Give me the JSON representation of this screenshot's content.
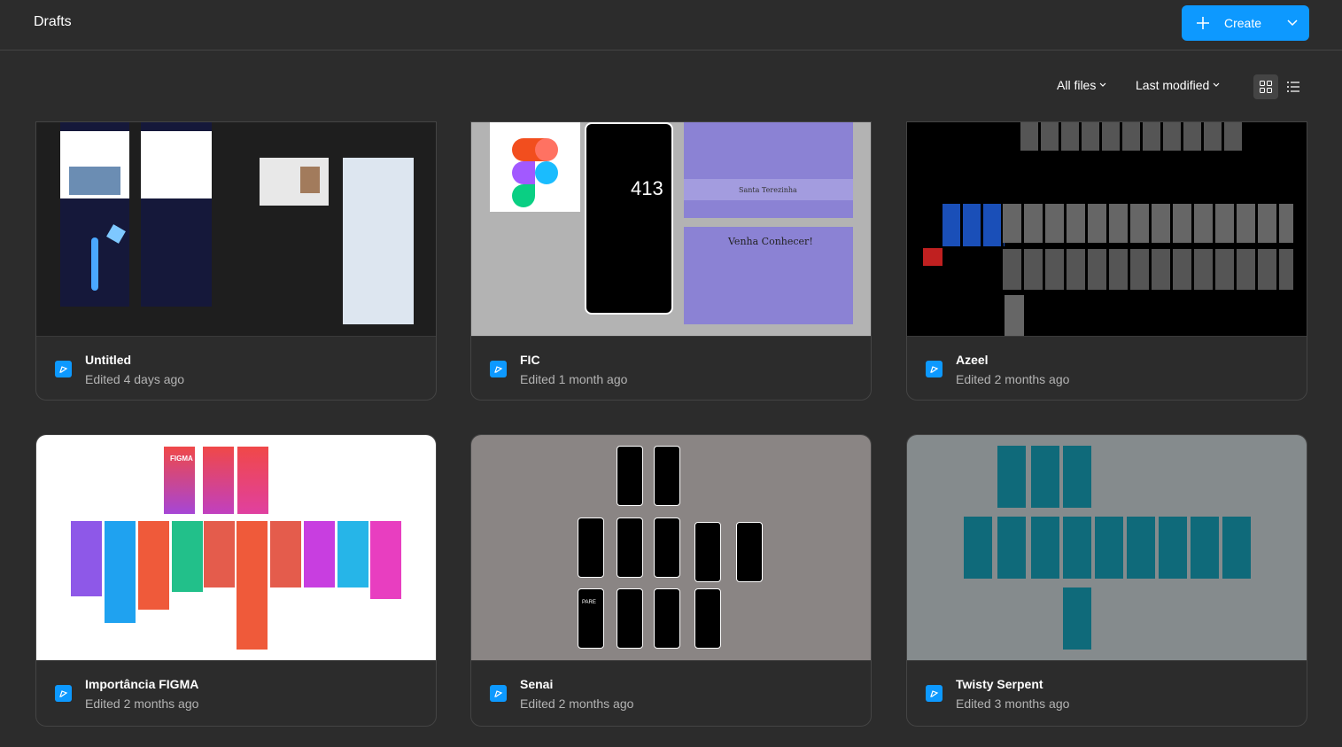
{
  "header": {
    "title": "Drafts",
    "create_label": "Create"
  },
  "toolbar": {
    "files_filter": "All files",
    "sort": "Last modified"
  },
  "colors": {
    "accent": "#0d99ff",
    "background": "#2c2c2c"
  },
  "files": [
    {
      "name": "Untitled",
      "edited": "Edited 4 days ago"
    },
    {
      "name": "FIC",
      "edited": "Edited 1 month ago"
    },
    {
      "name": "Azeel",
      "edited": "Edited 2 months ago"
    },
    {
      "name": "Importância FIGMA",
      "edited": "Edited 2 months ago"
    },
    {
      "name": "Senai",
      "edited": "Edited 2 months ago"
    },
    {
      "name": "Twisty Serpent",
      "edited": "Edited 3 months ago"
    }
  ],
  "thumbnails": {
    "fic": {
      "calc_display": "413",
      "brand_name": "Santa Terezinha",
      "cta": "Venha Conhecer!"
    },
    "importancia": {
      "banner": "FIGMA"
    },
    "senai": {
      "sign": "PARE"
    }
  }
}
